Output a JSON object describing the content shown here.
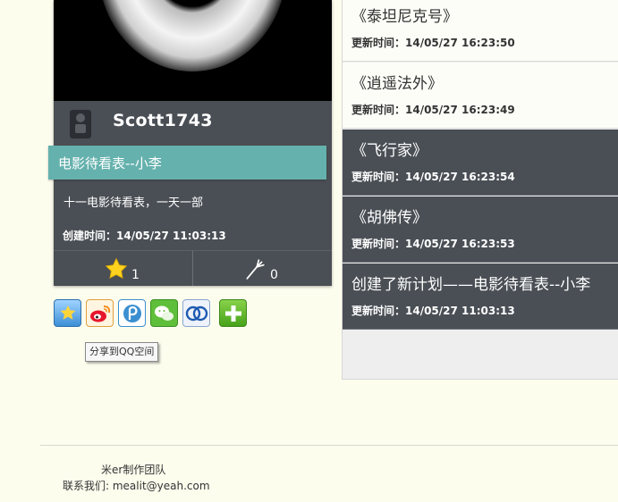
{
  "profile": {
    "username": "Scott1743"
  },
  "plan": {
    "title": "电影待看表--小李",
    "description": "十一电影待看表，一天一部",
    "created": "创建时间：14/05/27 11:03:13",
    "likes": "1",
    "forks": "0"
  },
  "share": {
    "icons": [
      "qzone-icon",
      "weibo-icon",
      "tencent-weibo-icon",
      "wechat-icon",
      "renren-icon",
      "more-icon"
    ],
    "tooltip": "分享到QQ空间"
  },
  "activity": [
    {
      "title": "《泰坦尼克号》",
      "time": "更新时间：14/05/27 16:23:50"
    },
    {
      "title": "《逍遥法外》",
      "time": "更新时间：14/05/27 16:23:49"
    },
    {
      "title": "《飞行家》",
      "time": "更新时间：14/05/27 16:23:54"
    },
    {
      "title": "《胡佛传》",
      "time": "更新时间：14/05/27 16:23:53"
    },
    {
      "title": "创建了新计划——电影待看表--小李",
      "time": "更新时间：14/05/27 11:03:13"
    }
  ],
  "footer": {
    "team": "米er制作团队",
    "contact": "联系我们: mealit@yeah.com"
  },
  "colors": {
    "card_bg": "#4a4f55",
    "accent": "#65b1ad",
    "page_bg": "#fdfdee"
  }
}
